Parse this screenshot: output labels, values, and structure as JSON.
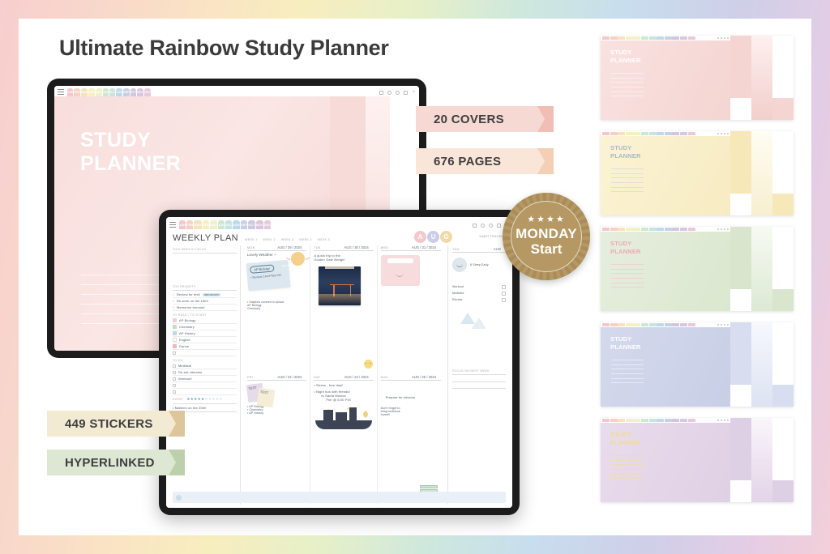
{
  "page": {
    "title": "Ultimate Rainbow Study Planner",
    "background_gradient": [
      "#f7cfcf",
      "#fae3c4",
      "#f7eebf",
      "#cfe8dd",
      "#c8ddee",
      "#cfcfe8",
      "#f3cfd9"
    ]
  },
  "ribbons": [
    {
      "label": "20 COVERS",
      "bg": "#f7d9d3",
      "tail": "#f1bdb4"
    },
    {
      "label": "676 PAGES",
      "bg": "#fae6d9",
      "tail": "#f5cfb3"
    },
    {
      "label": "449 STICKERS",
      "bg": "#f3ead3",
      "tail": "#ddc79a"
    },
    {
      "label": "HYPERLINKED",
      "bg": "#dde7d3",
      "tail": "#bcd0ac"
    }
  ],
  "badge": {
    "stars": "★★★★",
    "line1": "MONDAY",
    "line2": "Start",
    "color": "#b59863"
  },
  "months": [
    {
      "label": "JAN",
      "color": "#f5c6cb"
    },
    {
      "label": "FEB",
      "color": "#f7d0c4"
    },
    {
      "label": "MAR",
      "color": "#f6e2bd"
    },
    {
      "label": "APR",
      "color": "#f6f0c0"
    },
    {
      "label": "MAY",
      "color": "#eef2c8"
    },
    {
      "label": "JUN",
      "color": "#cfe8cd"
    },
    {
      "label": "JUL",
      "color": "#c7e4e0"
    },
    {
      "label": "AUG",
      "color": "#bedaea"
    },
    {
      "label": "SEP",
      "color": "#c8cfe6"
    },
    {
      "label": "OCT",
      "color": "#cfc6e2"
    },
    {
      "label": "NOV",
      "color": "#d9c6e0"
    },
    {
      "label": "DEC",
      "color": "#e7c9dd"
    }
  ],
  "cover": {
    "title_line1": "STUDY",
    "title_line2": "PLANNER"
  },
  "weekly": {
    "title": "WEEKLY PLAN",
    "weeks": [
      "WEEK 1",
      "WEEK 2",
      "WEEK 3",
      "WEEK 4",
      "WEEK 5"
    ],
    "month_circles": [
      {
        "letter": "A",
        "color": "#f3c8cd"
      },
      {
        "letter": "U",
        "color": "#c9cde8"
      },
      {
        "letter": "G",
        "color": "#f2d9a8"
      }
    ],
    "habit_tracker_label": "HABIT TRACKER",
    "left": {
      "focus_label": "THIS WEEK'S FOCUS",
      "top_priority_label": "TOP PRIORITY",
      "priorities": [
        {
          "num": "1",
          "text": "Review for test!",
          "tag": "IMPORTANT!"
        },
        {
          "num": "2",
          "text": "Re-work on the 16th!",
          "tag": ""
        },
        {
          "num": "3",
          "text": "Memorize formula!",
          "tag": ""
        }
      ],
      "to_read_label": "TO READ / TO STUDY",
      "subjects": [
        {
          "name": "AP Biology",
          "color": "#f3cdd3"
        },
        {
          "name": "Chemistry",
          "color": "#bfe0c2"
        },
        {
          "name": "AP History",
          "color": "#bed8e8"
        },
        {
          "name": "English",
          "color": "#ffffff"
        },
        {
          "name": "Dance",
          "color": "#f0b6c0"
        }
      ],
      "todo_label": "TO DO",
      "todos": [
        "Meditate",
        "Re-eat vitamins",
        "Workout!"
      ],
      "event_label": "EVENT",
      "event_stars_filled": 5,
      "event_stars_total": 10,
      "event_text": "• Midterm on the 20th!"
    },
    "days": [
      {
        "name": "MON",
        "date": "AUG / 29 / 2024"
      },
      {
        "name": "TUE",
        "date": "AUG / 30 / 2024"
      },
      {
        "name": "WED",
        "date": "AUG / 31 / 2024"
      },
      {
        "name": "FRI",
        "date": "AUG / 22 / 2024"
      },
      {
        "name": "SAT",
        "date": "AUG / 24 / 2024"
      },
      {
        "name": "SUN",
        "date": "AUG / 25 / 2024"
      }
    ],
    "notes": {
      "mon_sticker_title": "Lovely Weather ~",
      "mon_note_pill": "AP Biology",
      "mon_note_text": "• Review CHAPTER 20!",
      "mon_note_side": "REVIEW",
      "mon_subjects_head": "• Subjects covered in school:",
      "mon_subjects": [
        "AP Biology",
        "Chemistry"
      ],
      "tue_text_1": "A quick trip to the",
      "tue_text_2": "Golden Gate Bridge!",
      "fri_subjects": [
        "AP Biology",
        "Chemistry",
        "AP History"
      ],
      "fri_sticker_label": "TEST",
      "sat_line1": "• Stress - free day!!",
      "sat_line2": "• Night bus with friends!",
      "sat_line3": "to Santa Monica",
      "sat_line4": "Pier @ 6:00 P.M",
      "sun_line1": "Prepare for mission",
      "sun_line2": "Don't forget to",
      "sun_line3": "bring textbook",
      "sun_line4": "home!!",
      "focus_next_week_label": "FOCUS ON NEXT WEEK"
    },
    "habits": {
      "thu_label": "THU",
      "thu_date": "AUG",
      "sleep_note": "8 Sleep Early",
      "items": [
        "Workout",
        "Meditate",
        "Review"
      ]
    }
  },
  "thumbnails": [
    {
      "title_line1": "STUDY",
      "title_line2": "PLANNER",
      "bg": "#f6dcda",
      "text": "#ffffff",
      "strip": "#f4d2cf",
      "line": "#ffffff"
    },
    {
      "title_line1": "STUDY",
      "title_line2": "PLANNER",
      "bg": "#f8eec9",
      "text": "#aab7cc",
      "strip": "#f6e8bd",
      "line": "#c6cfdd"
    },
    {
      "title_line1": "STUDY",
      "title_line2": "PLANNER",
      "bg": "#dfe9d5",
      "text": "#f0a8b4",
      "strip": "#d7e4cc",
      "line": "#f0bcc4"
    },
    {
      "title_line1": "STUDY",
      "title_line2": "PLANNER",
      "bg": "#ccd2e8",
      "text": "#ffffff",
      "strip": "#d9def0",
      "line": "#ffffff"
    },
    {
      "title_line1": "STUDY",
      "title_line2": "PLANNER",
      "bg": "#e3d3e6",
      "text": "#f2dd8b",
      "strip": "#ded0e4",
      "line": "#f2dd8b"
    }
  ]
}
